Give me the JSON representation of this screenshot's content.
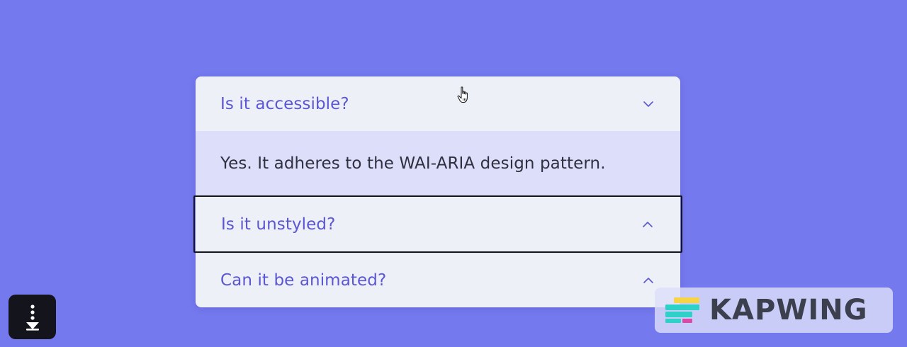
{
  "accordion": {
    "items": [
      {
        "question": "Is it accessible?",
        "answer": "Yes. It adheres to the WAI-ARIA design pattern.",
        "chevron": "chevron-down-icon",
        "expanded": true
      },
      {
        "question": "Is it unstyled?",
        "chevron": "chevron-up-icon",
        "expanded": false,
        "focused": true
      },
      {
        "question": "Can it be animated?",
        "chevron": "chevron-up-icon",
        "expanded": false
      }
    ]
  },
  "scroll_button": {
    "icon": "arrow-down-dots-icon"
  },
  "watermark": {
    "text": "KAPWING",
    "icon": "kapwing-logo-icon"
  },
  "colors": {
    "background": "#7579ee",
    "panel": "#eef0f8",
    "expanded_content": "#dddffa",
    "label": "#5b56d2",
    "focus_ring": "#15161c"
  }
}
